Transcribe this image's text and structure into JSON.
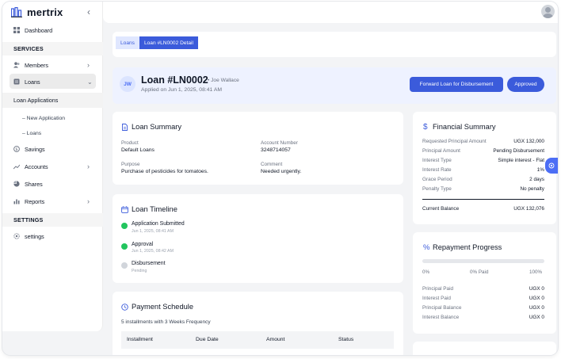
{
  "app": {
    "name": "mertrix"
  },
  "sidebar": {
    "dashboard": "Dashboard",
    "services_header": "SERVICES",
    "members": "Members",
    "loans": "Loans",
    "loan_applications": "Loan Applications",
    "new_application": "New Application",
    "loans_sub": "Loans",
    "savings": "Savings",
    "accounts": "Accounts",
    "shares": "Shares",
    "reports": "Reports",
    "settings_header": "SETTINGS",
    "settings": "settings"
  },
  "breadcrumb": {
    "first": "Loans",
    "current": "Loan #LN0002 Detail"
  },
  "loan": {
    "initials": "JW",
    "title": "Loan #LN0002",
    "user": "• Joe Wallace",
    "applied": "Applied on Jun 1, 2025, 08:41 AM",
    "forward_label": "Forward  Loan for Disbursement",
    "approved_label": "Approved"
  },
  "summary": {
    "title": "Loan Summary",
    "product_label": "Product",
    "product": "Default Loans",
    "account_label": "Account Number",
    "account": "3248714057",
    "purpose_label": "Purpose",
    "purpose": "Purchase of pesticides for tomatoes.",
    "comment_label": "Comment",
    "comment": "Needed urgently."
  },
  "timeline": {
    "title": "Loan Timeline",
    "steps": [
      {
        "title": "Application Submitted",
        "sub": "Jun 1, 2025, 08:41 AM",
        "color": "#22c55e"
      },
      {
        "title": "Approval",
        "sub": "Jun 1, 2025, 08:42 AM",
        "color": "#22c55e"
      },
      {
        "title": "Disbursement",
        "sub": "Pending",
        "color": "#d1d5db"
      }
    ]
  },
  "schedule": {
    "title": "Payment Schedule",
    "subtitle": "5 installments with 3 Weeks Frequency",
    "columns": [
      "Installment",
      "Due Date",
      "Amount",
      "Status"
    ]
  },
  "financial": {
    "title": "Financial Summary",
    "rows": [
      {
        "label": "Requested Principal Amount",
        "value": "UGX 132,000"
      },
      {
        "label": "Principal Amount",
        "value": "Pending Disbursement"
      },
      {
        "label": "Interest Type",
        "value": "Simple interest - Flat"
      },
      {
        "label": "Interest Rate",
        "value": "1%"
      },
      {
        "label": "Grace Period",
        "value": "2 days"
      },
      {
        "label": "Penalty Type",
        "value": "No penalty"
      }
    ],
    "balance_label": "Current Balance",
    "balance": "UGX 132,076"
  },
  "repayment": {
    "title": "Repayment Progress",
    "progress": 0,
    "left": "0%",
    "mid": "0% Paid",
    "right": "100%",
    "rows": [
      {
        "label": "Principal Paid",
        "value": "UGX 0"
      },
      {
        "label": "Interest Paid",
        "value": "UGX 0"
      },
      {
        "label": "Principal Balance",
        "value": "UGX 0"
      },
      {
        "label": "Interest Balance",
        "value": "UGX 0"
      }
    ]
  },
  "colors": {
    "accent": "#3b5bdb",
    "success": "#22c55e"
  }
}
